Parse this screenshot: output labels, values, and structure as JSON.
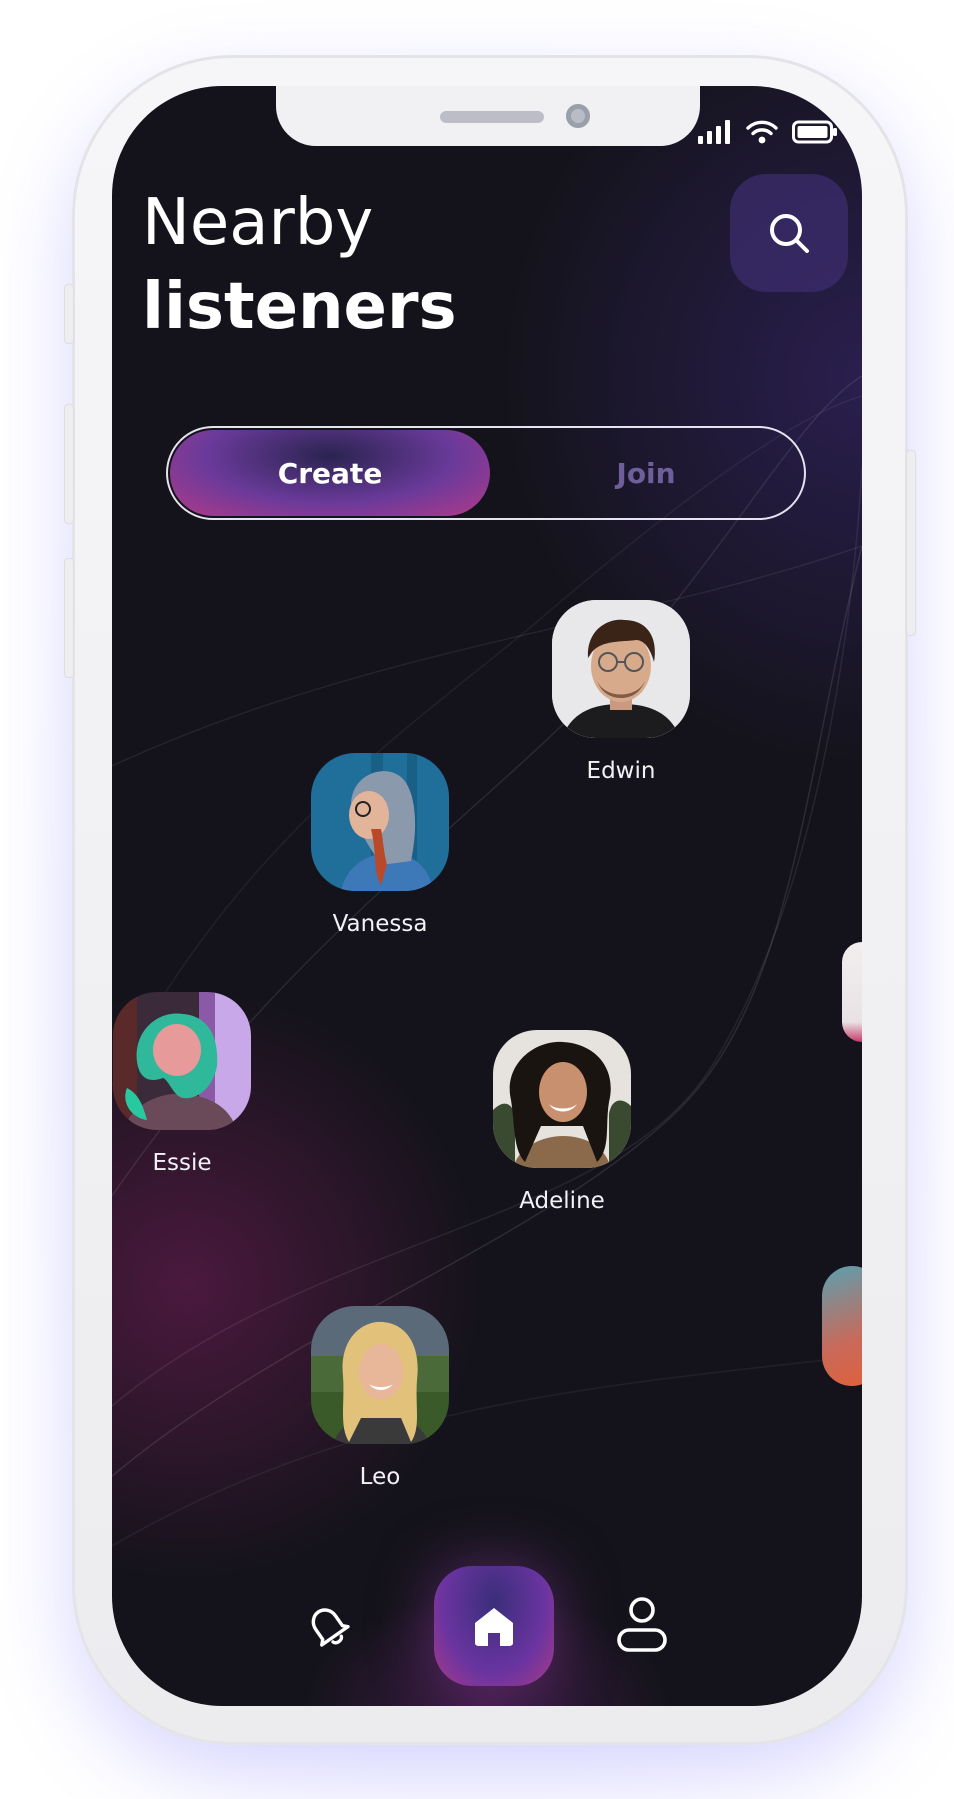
{
  "title": {
    "line1": "Nearby",
    "line2": "listeners"
  },
  "search": {
    "icon": "search-icon"
  },
  "toggle": {
    "active": "Create",
    "create_label": "Create",
    "join_label": "Join"
  },
  "listeners": [
    {
      "name": "Edwin"
    },
    {
      "name": "Vanessa"
    },
    {
      "name": "Essie"
    },
    {
      "name": "Adeline"
    },
    {
      "name": "Leo"
    }
  ],
  "nav": {
    "items": [
      "bell-icon",
      "home-icon",
      "profile-icon"
    ],
    "active": "home-icon"
  },
  "colors": {
    "background": "#14131b",
    "accent_purple": "#6a3a9a",
    "accent_pink": "#b23a8a",
    "join_text": "#6e5f9a"
  }
}
